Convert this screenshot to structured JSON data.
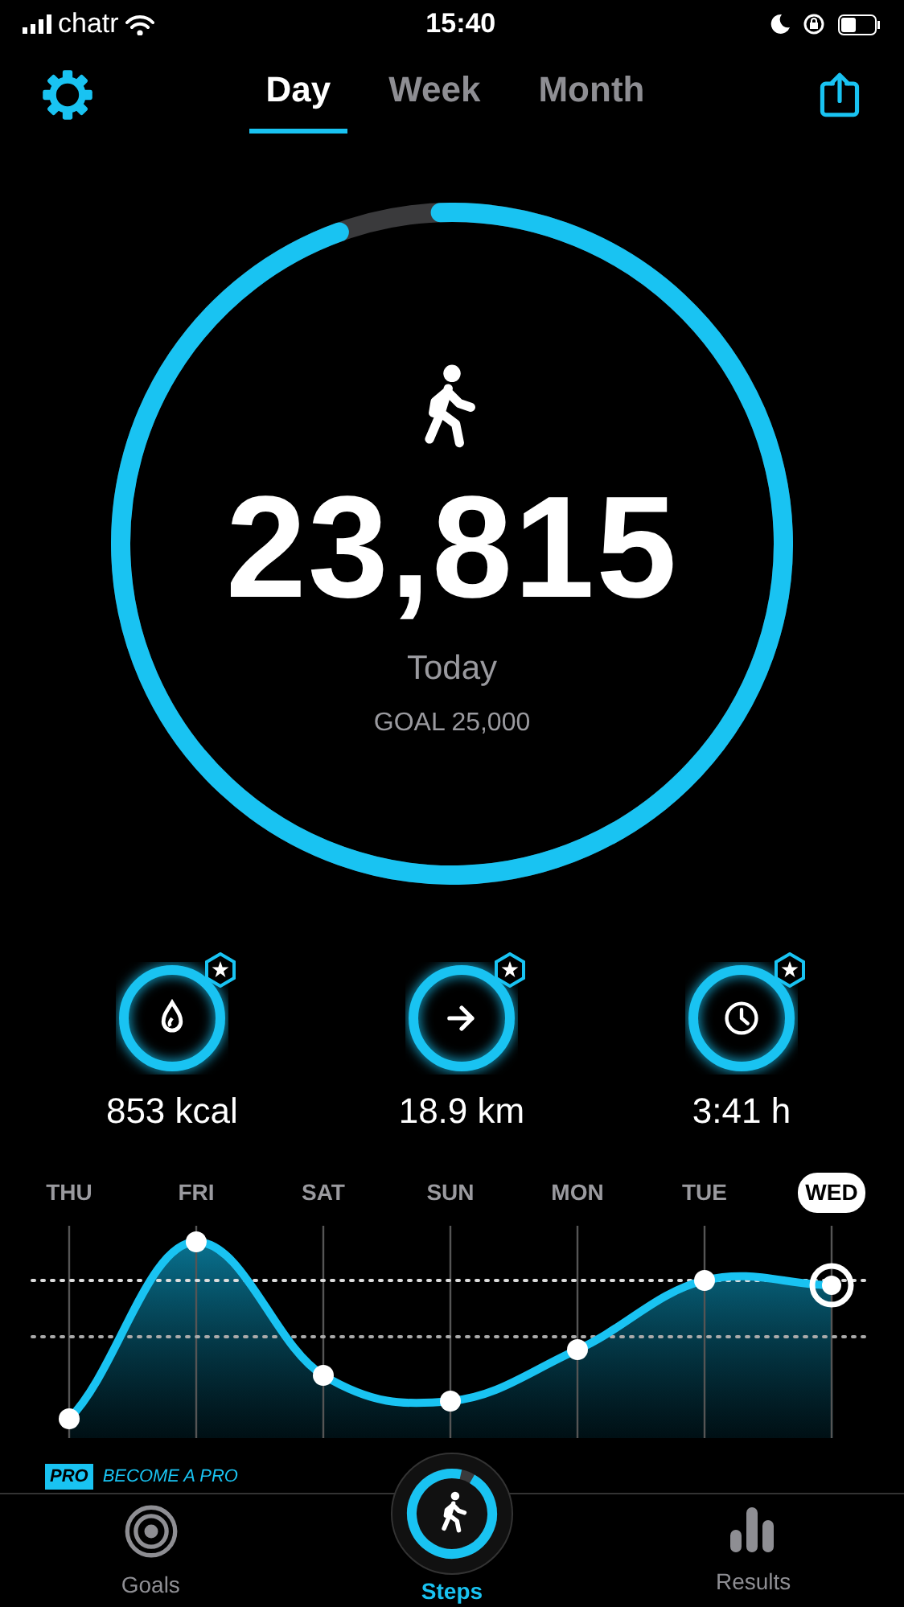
{
  "status_bar": {
    "carrier": "chatr",
    "time": "15:40"
  },
  "header": {
    "tabs": [
      {
        "label": "Day",
        "selected": true
      },
      {
        "label": "Week",
        "selected": false
      },
      {
        "label": "Month",
        "selected": false
      }
    ]
  },
  "steps": {
    "count": "23,815",
    "level": 0.95,
    "label": "Today",
    "goal": "GOAL 25,000"
  },
  "stats": [
    {
      "kind": "calories",
      "value": "853 kcal"
    },
    {
      "kind": "distance",
      "value": "18.9 km"
    },
    {
      "kind": "time",
      "value": "3:41 h"
    }
  ],
  "week": {
    "days": [
      {
        "label": "THU",
        "selected": false
      },
      {
        "label": "FRI",
        "selected": false
      },
      {
        "label": "SAT",
        "selected": false
      },
      {
        "label": "SUN",
        "selected": false
      },
      {
        "label": "MON",
        "selected": false
      },
      {
        "label": "TUE",
        "selected": false
      },
      {
        "label": "WED",
        "selected": true
      }
    ]
  },
  "promo": {
    "badge": "PRO",
    "text": "BECOME A PRO"
  },
  "tab_bar": [
    {
      "kind": "goals",
      "label": "Goals",
      "selected": false
    },
    {
      "kind": "steps",
      "label": "Steps",
      "selected": true,
      "level": 0.95
    },
    {
      "kind": "results",
      "label": "Results",
      "selected": false
    }
  ]
}
